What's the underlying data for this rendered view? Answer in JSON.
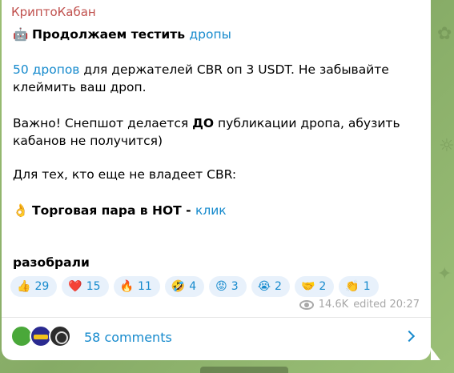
{
  "channel": {
    "name": "КриптоКабан"
  },
  "message": {
    "title_prefix": "Продолжаем тестить ",
    "title_link": "дропы",
    "p1_link": "50 дропов",
    "p1_line1": " для держателей CBR оп 3 USDT. Не забывайте",
    "p1_line2": "клеймить ваш дроп.",
    "p2_line1_a": "Важно! Снепшот делается ",
    "p2_line1_bold": "ДО",
    "p2_line1_b": " публикации дропа, абузить",
    "p2_line2": "кабанов не получится)",
    "p3": "Для тех, кто еще не владеет CBR:",
    "pair_emoji": "👌",
    "pair_text": "Торговая пара в HOT - ",
    "pair_link": "клик",
    "footer_bold": "разобрали"
  },
  "reactions": [
    {
      "emoji": "👍",
      "count": "29"
    },
    {
      "emoji": "❤️",
      "count": "15"
    },
    {
      "emoji": "🔥",
      "count": "11"
    },
    {
      "emoji": "🤣",
      "count": "4"
    },
    {
      "emoji": "😡",
      "count": "3"
    },
    {
      "emoji": "😭",
      "count": "2"
    },
    {
      "emoji": "🤝",
      "count": "2"
    },
    {
      "emoji": "👏",
      "count": "1"
    }
  ],
  "meta": {
    "views": "14.6K",
    "edited": "edited 20:27"
  },
  "comments": {
    "label": "58 comments"
  },
  "icons": {
    "views": "eye-icon",
    "chevron": "chevron-right-icon",
    "title": "robot-icon"
  }
}
